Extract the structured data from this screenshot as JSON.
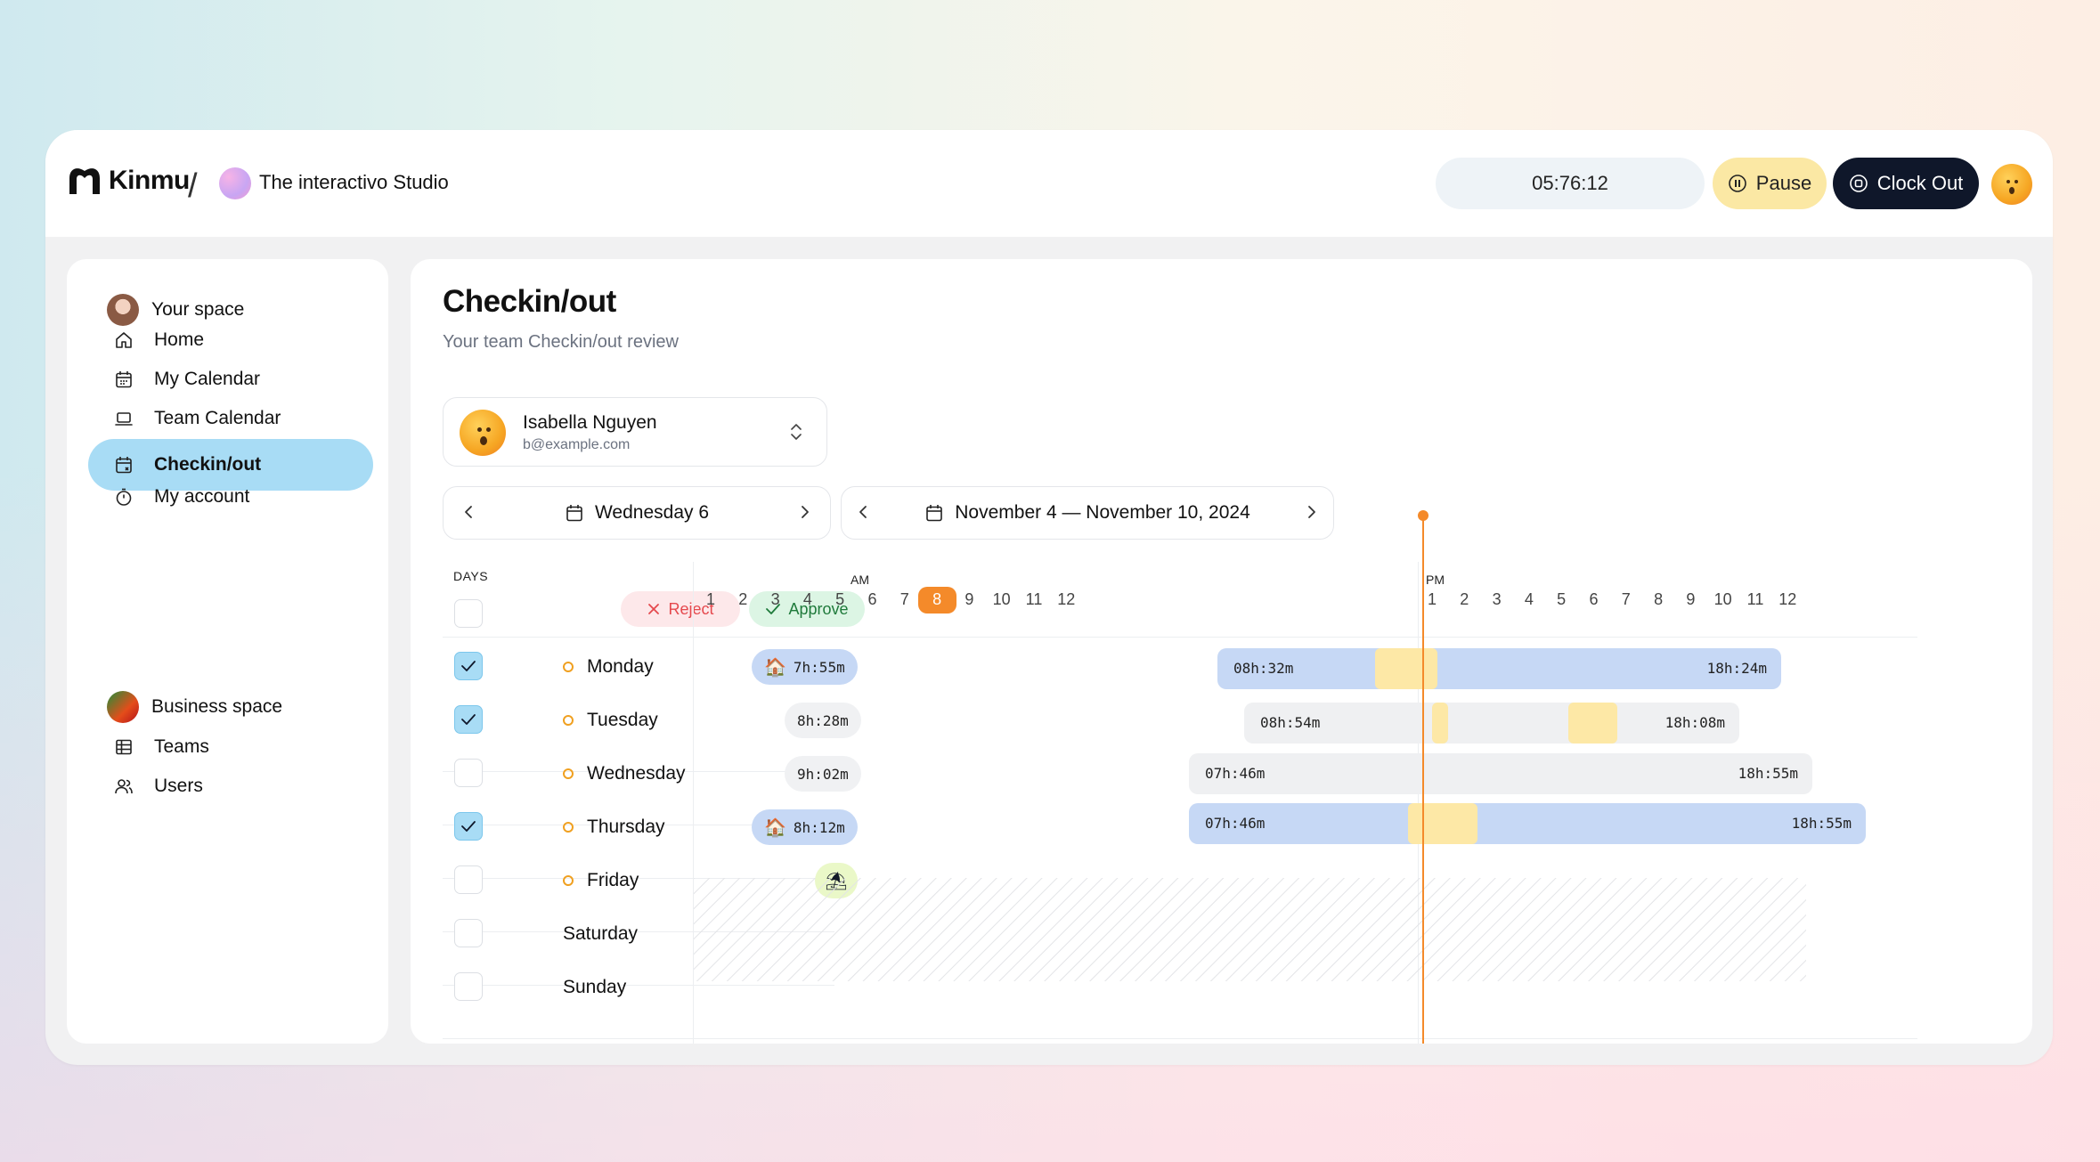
{
  "header": {
    "brand": "Kinmu",
    "workspace": "The interactivo Studio",
    "timer": "05:76:12",
    "pause_label": "Pause",
    "clockout_label": "Clock Out"
  },
  "sidebar": {
    "your_space": "Your space",
    "items": [
      {
        "label": "Home",
        "icon": "home-icon"
      },
      {
        "label": "My Calendar",
        "icon": "calendar-icon"
      },
      {
        "label": "Team Calendar",
        "icon": "laptop-icon"
      },
      {
        "label": "Checkin/out",
        "icon": "calendar-check-icon",
        "active": true
      },
      {
        "label": "My account",
        "icon": "stopwatch-icon"
      }
    ],
    "business_space": "Business space",
    "business_items": [
      {
        "label": "Teams",
        "icon": "grid-icon"
      },
      {
        "label": "Users",
        "icon": "users-icon"
      }
    ]
  },
  "page": {
    "title": "Checkin/out",
    "subtitle": "Your team Checkin/out review"
  },
  "user": {
    "name": "Isabella Nguyen",
    "email": "b@example.com"
  },
  "day_nav": {
    "label": "Wednesday 6"
  },
  "week_nav": {
    "label": "November 4 — November 10, 2024"
  },
  "table": {
    "days_header": "DAYS",
    "reject_label": "Reject",
    "approve_label": "Approve",
    "am_label": "AM",
    "pm_label": "PM",
    "hours_am": [
      "1",
      "2",
      "3",
      "4",
      "5",
      "6",
      "7",
      "8",
      "9",
      "10",
      "11",
      "12"
    ],
    "hours_pm": [
      "1",
      "2",
      "3",
      "4",
      "5",
      "6",
      "7",
      "8",
      "9",
      "10",
      "11",
      "12"
    ],
    "current_hour": "8",
    "rows": [
      {
        "day": "Monday",
        "checked": true,
        "duration": "7h:55m",
        "remote": true,
        "start": "08h:32m",
        "end": "18h:24m"
      },
      {
        "day": "Tuesday",
        "checked": true,
        "duration": "8h:28m",
        "remote": false,
        "start": "08h:54m",
        "end": "18h:08m"
      },
      {
        "day": "Wednesday",
        "checked": false,
        "duration": "9h:02m",
        "remote": false,
        "start": "07h:46m",
        "end": "18h:55m"
      },
      {
        "day": "Thursday",
        "checked": true,
        "duration": "8h:12m",
        "remote": true,
        "start": "07h:46m",
        "end": "18h:55m"
      },
      {
        "day": "Friday",
        "checked": false,
        "duration": "",
        "status": "holiday"
      },
      {
        "day": "Saturday",
        "checked": false
      },
      {
        "day": "Sunday",
        "checked": false
      }
    ]
  },
  "colors": {
    "accent": "#a8dcf5",
    "now": "#f48a2a",
    "bar_blue": "#c6d8f5",
    "bar_grey": "#eff0f2",
    "break": "#fde8a6",
    "dark": "#0f172a"
  }
}
